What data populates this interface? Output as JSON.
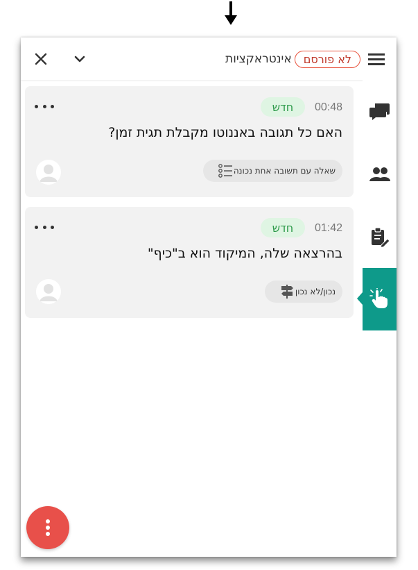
{
  "header": {
    "title": "אינטראקציות",
    "status_badge": "לא פורסם",
    "menu_icon": "hamburger-menu-icon",
    "collapse_icon": "chevron-down-icon",
    "close_icon": "close-icon"
  },
  "side_tabs": [
    {
      "icon": "chat-icon",
      "active": false
    },
    {
      "icon": "participants-icon",
      "active": false
    },
    {
      "icon": "clipboard-edit-icon",
      "active": false
    },
    {
      "icon": "hand-tap-icon",
      "active": true
    }
  ],
  "cards": [
    {
      "time": "00:48",
      "badge": "חדש",
      "text": "האם כל תגובה באננוטו מקבלת תגית זמן?",
      "type_label": "שאלה עם תשובה אחת נכונה",
      "type_icon": "list-icon"
    },
    {
      "time": "01:42",
      "badge": "חדש",
      "text": "בהרצאה שלה, המיקוד הוא ב\"כיף\"",
      "type_label": "נכון/לא נכון",
      "type_icon": "signpost-icon"
    }
  ],
  "fab_icon": "vertical-dots-icon",
  "colors": {
    "accent_teal": "#0e9a8a",
    "fab_red": "#e8504a",
    "badge_red": "#e8543e",
    "new_green": "#2d9a4a",
    "new_green_bg": "#dff5e3",
    "card_bg": "#f2f2f2"
  }
}
